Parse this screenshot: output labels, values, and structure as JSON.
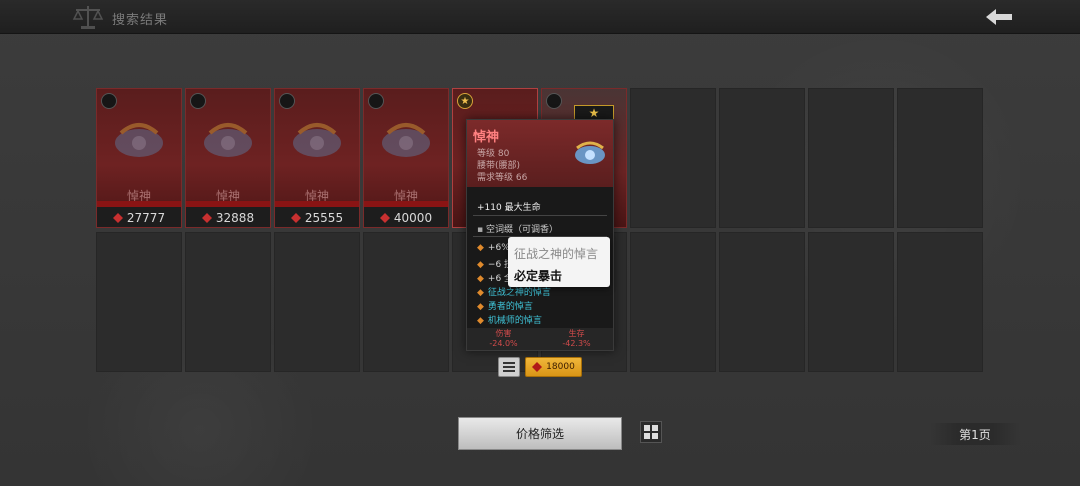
{
  "header": {
    "title": "搜索结果",
    "logo_icon": "scales-icon",
    "back_icon": "back-arrow-icon"
  },
  "items": [
    {
      "name": "悼神",
      "price": "27777",
      "badge": "dark"
    },
    {
      "name": "悼神",
      "price": "32888",
      "badge": "dark"
    },
    {
      "name": "悼神",
      "price": "25555",
      "badge": "dark"
    },
    {
      "name": "悼神",
      "price": "40000",
      "badge": "dark"
    },
    {
      "name": "悼神",
      "price": "",
      "badge": "gold"
    },
    {
      "name": "",
      "price": "",
      "badge": "dark",
      "star": "★"
    }
  ],
  "tooltip": {
    "name": "悼神",
    "level": "等级 80",
    "slot": "腰带(腰部)",
    "required_level": "需求等级 66",
    "main_stat": "+110 最大生命",
    "socket": "空词缀（可调香）",
    "affixes": [
      {
        "text": "+6%",
        "style": "normal"
      },
      {
        "text": "−6 技",
        "style": "normal"
      },
      {
        "text": "+6 全",
        "style": "normal"
      },
      {
        "text": "征战之神的悼言",
        "style": "cyan"
      },
      {
        "text": "勇者的悼言",
        "style": "cyan"
      },
      {
        "text": "机械师的悼言",
        "style": "cyan"
      }
    ],
    "footer": {
      "damage_label": "伤害",
      "damage_value": "-24.0%",
      "survival_label": "生存",
      "survival_value": "-42.3%"
    }
  },
  "popup": {
    "title": "征战之神的悼言",
    "desc": "必定暴击"
  },
  "buy": {
    "price": "18000",
    "currency_icon": "currency-icon",
    "menu_icon": "list-icon"
  },
  "footer": {
    "filter_label": "价格筛选",
    "grid_icon": "grid-icon",
    "page_label": "第1页"
  },
  "colors": {
    "item_red": "#6e2222",
    "price_gold": "#e7a52a",
    "affix_cyan": "#3fc2d6",
    "stat_red": "#d24b4b"
  }
}
